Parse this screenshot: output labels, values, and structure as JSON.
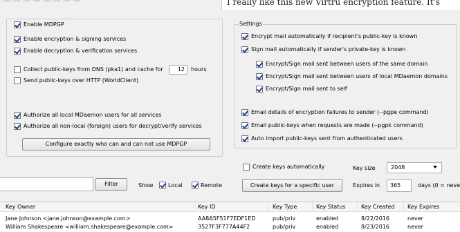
{
  "note_text": "I really like this new Virtru encryption feature. It's",
  "general": {
    "enable_mdpgp": {
      "label": "Enable MDPGP",
      "checked": true
    },
    "enable_encryption": {
      "label": "Enable encryption & signing services",
      "checked": true
    },
    "enable_decryption": {
      "label": "Enable decryption & verification services",
      "checked": true
    },
    "collect_keys": {
      "label": "Collect public-keys from DNS (pka1) and cache for",
      "checked": false
    },
    "collect_hours_value": "12",
    "collect_hours_label": "hours",
    "send_keys_http": {
      "label": "Send public-keys over HTTP (WorldClient)",
      "checked": false
    },
    "authorize_local": {
      "label": "Authorize all local MDaemon users for all services",
      "checked": true
    },
    "authorize_nonlocal": {
      "label": "Authorize all non-local (foreign) users for decrypt/verify services",
      "checked": true
    },
    "configure_button": "Configure exactly who can and can not use MDPGP"
  },
  "settings": {
    "title": "Settings",
    "encrypt_auto": {
      "label": "Encrypt mail automatically if recipient's public-key is known",
      "checked": true
    },
    "sign_auto": {
      "label": "Sign mail automatically if sender's private-key is known",
      "checked": true
    },
    "sub_same_domain": {
      "label": "Encrypt/Sign mail sent between users of the same domain",
      "checked": true
    },
    "sub_local_domains": {
      "label": "Encrypt/Sign mail sent between users of local MDaemon domains",
      "checked": true
    },
    "sub_self": {
      "label": "Encrypt/Sign mail sent to self",
      "checked": true
    },
    "email_failures": {
      "label": "Email details of encryption failures to sender (--pgpe command)",
      "checked": true
    },
    "email_pubkeys": {
      "label": "Email public-keys when requests are made (--pgpk command)",
      "checked": true
    },
    "auto_import": {
      "label": "Auto import public-keys sent from authenticated users",
      "checked": true
    }
  },
  "keys": {
    "create_auto": {
      "label": "Create keys automatically",
      "checked": false
    },
    "key_size_label": "Key size",
    "key_size_value": "2048",
    "create_specific_button": "Create keys for a specific user",
    "expires_label": "Expires in",
    "expires_value": "365",
    "expires_hint": "days (0 = neve"
  },
  "filter": {
    "button": "Filter",
    "show_label": "Show",
    "local": {
      "label": "Local",
      "checked": true
    },
    "remote": {
      "label": "Remote",
      "checked": true
    }
  },
  "table": {
    "headers": [
      "Key Owner",
      "Key ID",
      "Key Type",
      "Key Status",
      "Key Created",
      "Key Expires"
    ],
    "rows": [
      [
        "Jane Johnson <jane.johnson@example.com>",
        "AA8A5F51F7EDF1ED",
        "pub/priv",
        "enabled",
        "8/22/2016",
        "never"
      ],
      [
        "William Shakespeare <william.shakespeare@example.com>",
        "3527F3F777A44F2",
        "pub/priv",
        "enabled",
        "8/23/2016",
        "never"
      ]
    ]
  }
}
